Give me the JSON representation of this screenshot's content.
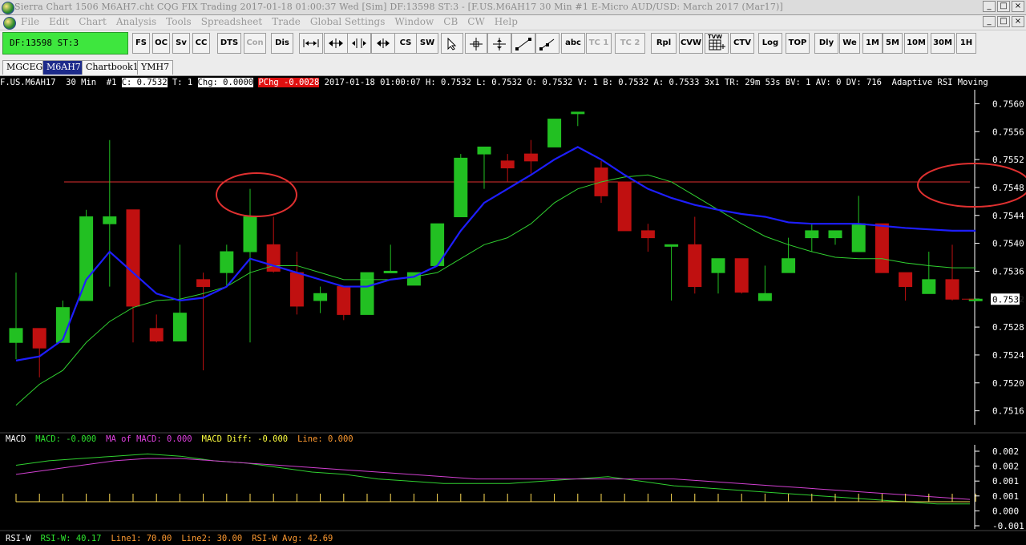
{
  "window": {
    "title": "Sierra Chart 1506 M6AH7.cht  CQG FIX Trading 2017-01-18  01:00:37 Wed [Sim]  DF:13598  ST:3 - [F.US.M6AH17  30 Min  #1  E-Micro AUD/USD: March 2017 (Mar17)]",
    "buttons": [
      "_",
      "□",
      "×"
    ],
    "inner_buttons": [
      "_",
      "□",
      "×"
    ]
  },
  "menu": [
    "File",
    "Edit",
    "Chart",
    "Analysis",
    "Tools",
    "Spreadsheet",
    "Trade",
    "Global Settings",
    "Window",
    "CB",
    "CW",
    "Help"
  ],
  "status_box": "DF:13598  ST:3",
  "toolbar": {
    "buttons": [
      {
        "label": "FS",
        "dim": false
      },
      {
        "label": "OC",
        "dim": false
      },
      {
        "label": "Sv",
        "dim": false
      },
      {
        "label": "CC",
        "dim": false
      },
      {
        "label": "DTS",
        "dim": false
      },
      {
        "label": "Con",
        "dim": true
      },
      {
        "label": "Dis",
        "dim": false
      },
      {
        "label": "",
        "icon": "horizontal-resize-icon"
      },
      {
        "label": "",
        "icon": "expand-horizontal-icon"
      },
      {
        "label": "",
        "icon": "scroll-left-icon"
      },
      {
        "label": "",
        "icon": "scroll-right-icon"
      },
      {
        "label": "CS",
        "dim": false
      },
      {
        "label": "SW",
        "dim": false
      },
      {
        "label": "",
        "icon": "pointer-icon"
      },
      {
        "label": "",
        "icon": "crosshair-icon"
      },
      {
        "label": "",
        "icon": "cursor-cross-icon"
      },
      {
        "label": "",
        "icon": "line-tool-icon"
      },
      {
        "label": "",
        "icon": "ray-tool-icon"
      },
      {
        "label": "abc",
        "dim": false
      },
      {
        "label": "TC 1",
        "dim": true
      },
      {
        "label": "TC 2",
        "dim": true
      },
      {
        "label": "Rpl",
        "dim": false
      },
      {
        "label": "CVW",
        "dim": false
      },
      {
        "label": "TVW",
        "icon": "trade-window-icon"
      },
      {
        "label": "CTV",
        "dim": false
      },
      {
        "label": "Log",
        "dim": false
      },
      {
        "label": "TOP",
        "dim": false
      },
      {
        "label": "Dly",
        "dim": false
      },
      {
        "label": "We",
        "dim": false
      },
      {
        "label": "1M",
        "dim": false
      },
      {
        "label": "5M",
        "dim": false
      },
      {
        "label": "10M",
        "dim": false
      },
      {
        "label": "30M",
        "dim": false
      },
      {
        "label": "1H",
        "dim": false
      }
    ]
  },
  "tabs": [
    {
      "label": "MGCEG7",
      "active": false
    },
    {
      "label": "M6AH7",
      "active": true
    },
    {
      "label": "Chartbook1",
      "active": false
    },
    {
      "label": "YMH7",
      "active": false
    }
  ],
  "info": {
    "symbol": "F.US.M6AH17  30 Min  #1 ",
    "close": "C: 0.7532",
    "trades": " T: 1 ",
    "chg": "Chg: 0.0000",
    "pchg": "PChg -0.0028",
    "rest": " 2017-01-18 01:00:07 H: 0.7532 L: 0.7532 O: 0.7532 V: 1 B: 0.7532 A: 0.7533 3x1 TR: 29m 53s BV: 1 AV: 0 DV: 716  Adaptive RSI Moving Average"
  },
  "price_axis": {
    "ticks": [
      "0.7560",
      "0.7556",
      "0.7552",
      "0.7548",
      "0.7544",
      "0.7540",
      "0.7536",
      "0.7532",
      "0.7528",
      "0.7524",
      "0.7520",
      "0.7516"
    ],
    "last_price": "0.7532"
  },
  "macd": {
    "labels": [
      {
        "text": "MACD",
        "color": "#ffffff"
      },
      {
        "text": "MACD: -0.000",
        "color": "#2ee62e"
      },
      {
        "text": "MA of MACD: 0.000",
        "color": "#e040e0"
      },
      {
        "text": "MACD Diff: -0.000",
        "color": "#ffff40"
      },
      {
        "text": "Line: 0.000",
        "color": "#ff9a30"
      }
    ],
    "ticks": [
      "0.002",
      "0.002",
      "0.001",
      "0.001",
      "0.000",
      "-0.001"
    ]
  },
  "rsi": {
    "labels": [
      {
        "text": "RSI-W",
        "color": "#ffffff"
      },
      {
        "text": "RSI-W: 40.17",
        "color": "#2ee62e"
      },
      {
        "text": "Line1: 70.00",
        "color": "#ff9a30"
      },
      {
        "text": "Line2: 30.00",
        "color": "#ff9a30"
      },
      {
        "text": "RSI-W Avg: 42.69",
        "color": "#ff9a30"
      }
    ]
  },
  "colors": {
    "up_candle": "#22c022",
    "down_candle": "#c01010",
    "ma_fast": "#1e1eff",
    "ma_slow": "#30d030",
    "annotation": "#e03030"
  },
  "chart_data": [
    {
      "type": "candlestick",
      "title": "F.US.M6AH17 30 Min",
      "ylim": [
        0.7514,
        0.7562
      ],
      "candles": [
        {
          "o": 0.75258,
          "h": 0.75358,
          "l": 0.75234,
          "c": 0.75278
        },
        {
          "o": 0.75278,
          "h": 0.75278,
          "l": 0.75208,
          "c": 0.7525
        },
        {
          "o": 0.75258,
          "h": 0.75318,
          "l": 0.75258,
          "c": 0.75308
        },
        {
          "o": 0.75318,
          "h": 0.75448,
          "l": 0.75318,
          "c": 0.75438
        },
        {
          "o": 0.75428,
          "h": 0.75548,
          "l": 0.75338,
          "c": 0.75438
        },
        {
          "o": 0.75448,
          "h": 0.75448,
          "l": 0.75258,
          "c": 0.7531
        },
        {
          "o": 0.75278,
          "h": 0.75298,
          "l": 0.75258,
          "c": 0.7526
        },
        {
          "o": 0.7526,
          "h": 0.75398,
          "l": 0.7526,
          "c": 0.753
        },
        {
          "o": 0.75348,
          "h": 0.75358,
          "l": 0.75218,
          "c": 0.75338
        },
        {
          "o": 0.75358,
          "h": 0.75398,
          "l": 0.75338,
          "c": 0.75388
        },
        {
          "o": 0.75388,
          "h": 0.75478,
          "l": 0.75258,
          "c": 0.75438
        },
        {
          "o": 0.75398,
          "h": 0.75438,
          "l": 0.75358,
          "c": 0.7536
        },
        {
          "o": 0.75358,
          "h": 0.75388,
          "l": 0.75298,
          "c": 0.7531
        },
        {
          "o": 0.75318,
          "h": 0.75338,
          "l": 0.753,
          "c": 0.75328
        },
        {
          "o": 0.75338,
          "h": 0.75338,
          "l": 0.7529,
          "c": 0.75298
        },
        {
          "o": 0.75298,
          "h": 0.75358,
          "l": 0.75298,
          "c": 0.75358
        },
        {
          "o": 0.75358,
          "h": 0.75398,
          "l": 0.75358,
          "c": 0.7536
        },
        {
          "o": 0.7534,
          "h": 0.75358,
          "l": 0.7534,
          "c": 0.75358
        },
        {
          "o": 0.75368,
          "h": 0.75428,
          "l": 0.75368,
          "c": 0.75428
        },
        {
          "o": 0.75438,
          "h": 0.75528,
          "l": 0.75438,
          "c": 0.75522
        },
        {
          "o": 0.75528,
          "h": 0.75538,
          "l": 0.75478,
          "c": 0.75538
        },
        {
          "o": 0.75518,
          "h": 0.75528,
          "l": 0.75488,
          "c": 0.75508
        },
        {
          "o": 0.75528,
          "h": 0.75548,
          "l": 0.755,
          "c": 0.75518
        },
        {
          "o": 0.75538,
          "h": 0.75578,
          "l": 0.75538,
          "c": 0.75578
        },
        {
          "o": 0.75588,
          "h": 0.75588,
          "l": 0.75568,
          "c": 0.75588
        },
        {
          "o": 0.75508,
          "h": 0.75518,
          "l": 0.75458,
          "c": 0.75468
        },
        {
          "o": 0.75488,
          "h": 0.75488,
          "l": 0.75418,
          "c": 0.75418
        },
        {
          "o": 0.75418,
          "h": 0.75428,
          "l": 0.75388,
          "c": 0.75408
        },
        {
          "o": 0.75398,
          "h": 0.75398,
          "l": 0.75318,
          "c": 0.75398
        },
        {
          "o": 0.75398,
          "h": 0.75438,
          "l": 0.75328,
          "c": 0.75338
        },
        {
          "o": 0.75358,
          "h": 0.75378,
          "l": 0.75328,
          "c": 0.75378
        },
        {
          "o": 0.75378,
          "h": 0.75378,
          "l": 0.75328,
          "c": 0.7533
        },
        {
          "o": 0.75318,
          "h": 0.75368,
          "l": 0.75318,
          "c": 0.75328
        },
        {
          "o": 0.75358,
          "h": 0.75408,
          "l": 0.75358,
          "c": 0.75378
        },
        {
          "o": 0.75408,
          "h": 0.75428,
          "l": 0.75388,
          "c": 0.75418
        },
        {
          "o": 0.75408,
          "h": 0.75418,
          "l": 0.75398,
          "c": 0.75418
        },
        {
          "o": 0.75388,
          "h": 0.75468,
          "l": 0.75388,
          "c": 0.75428
        },
        {
          "o": 0.75428,
          "h": 0.75428,
          "l": 0.75358,
          "c": 0.75358
        },
        {
          "o": 0.75358,
          "h": 0.75358,
          "l": 0.75318,
          "c": 0.75338
        },
        {
          "o": 0.75328,
          "h": 0.75388,
          "l": 0.75328,
          "c": 0.75348
        },
        {
          "o": 0.75348,
          "h": 0.75398,
          "l": 0.75318,
          "c": 0.7532
        },
        {
          "o": 0.7532,
          "h": 0.7532,
          "l": 0.7532,
          "c": 0.7532
        }
      ],
      "ma_fast": [
        0.75232,
        0.75238,
        0.75262,
        0.75348,
        0.75388,
        0.75358,
        0.75328,
        0.75318,
        0.75322,
        0.75338,
        0.75378,
        0.75368,
        0.75358,
        0.75348,
        0.75338,
        0.75338,
        0.75348,
        0.75352,
        0.75368,
        0.75418,
        0.75458,
        0.75478,
        0.75498,
        0.7552,
        0.75538,
        0.7552,
        0.75498,
        0.75478,
        0.75465,
        0.75455,
        0.75448,
        0.75442,
        0.75438,
        0.7543,
        0.75428,
        0.75428,
        0.75428,
        0.75425,
        0.75422,
        0.7542,
        0.75418,
        0.75418
      ],
      "ma_slow": [
        0.75168,
        0.75198,
        0.75218,
        0.75258,
        0.75288,
        0.75308,
        0.75318,
        0.7532,
        0.75328,
        0.75338,
        0.75358,
        0.75368,
        0.75368,
        0.75358,
        0.75348,
        0.75348,
        0.75348,
        0.75352,
        0.75358,
        0.75378,
        0.75398,
        0.75408,
        0.75428,
        0.75458,
        0.75478,
        0.75488,
        0.75495,
        0.75498,
        0.75488,
        0.75468,
        0.75448,
        0.75428,
        0.7541,
        0.75398,
        0.75388,
        0.7538,
        0.75378,
        0.75378,
        0.75372,
        0.75368,
        0.75365,
        0.75365
      ],
      "hline": 0.75488
    },
    {
      "type": "line",
      "title": "MACD",
      "ylim": [
        -0.0012,
        0.0025
      ],
      "series": [
        {
          "name": "MACD",
          "values": [
            0.0016,
            0.0018,
            0.0019,
            0.002,
            0.0021,
            0.002,
            0.0018,
            0.0017,
            0.0015,
            0.0013,
            0.0012,
            0.001,
            0.0009,
            0.0008,
            0.0008,
            0.0008,
            0.0009,
            0.001,
            0.0011,
            0.0009,
            0.0007,
            0.0006,
            0.0005,
            0.0004,
            0.0003,
            0.0002,
            0.0001,
            0.0,
            -0.0001,
            -0.0001
          ]
        },
        {
          "name": "MA of MACD",
          "values": [
            0.0012,
            0.0014,
            0.0016,
            0.0018,
            0.0019,
            0.0019,
            0.0018,
            0.0017,
            0.0016,
            0.0015,
            0.0014,
            0.0013,
            0.0012,
            0.0011,
            0.001,
            0.001,
            0.001,
            0.001,
            0.001,
            0.001,
            0.001,
            0.0009,
            0.0008,
            0.0007,
            0.0006,
            0.0005,
            0.0004,
            0.0003,
            0.0002,
            0.0001
          ]
        }
      ]
    }
  ]
}
